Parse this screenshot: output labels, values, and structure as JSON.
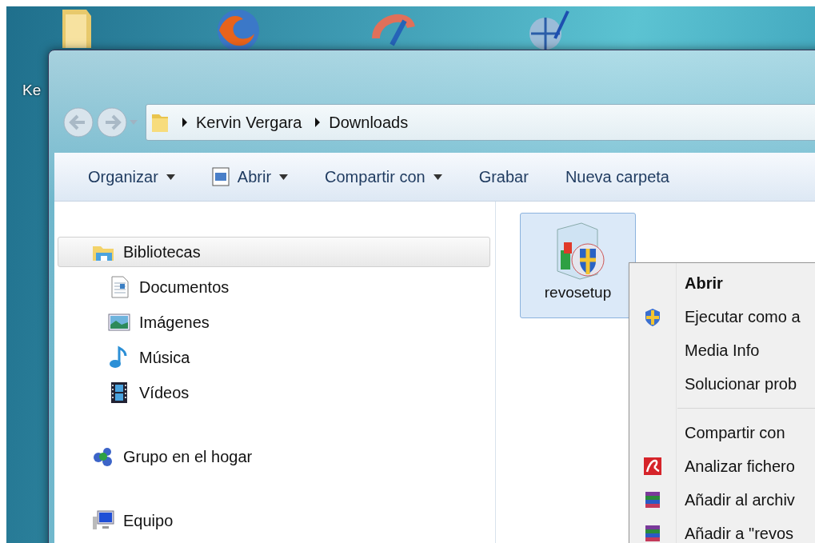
{
  "desktop": {
    "icon_label": "Ke"
  },
  "window": {
    "address_path": [
      "Kervin Vergara",
      "Downloads"
    ],
    "toolbar": [
      {
        "label": "Organizar",
        "kind": "menu"
      },
      {
        "label": "Abrir",
        "kind": "icon-menu"
      },
      {
        "label": "Compartir con",
        "kind": "menu"
      },
      {
        "label": "Grabar",
        "kind": "command"
      },
      {
        "label": "Nueva carpeta",
        "kind": "command"
      }
    ],
    "nav_pane": [
      {
        "label": "Bibliotecas",
        "kind": "library",
        "selected": true,
        "children": [
          {
            "label": "Documentos",
            "kind": "documents",
            "selected": false
          },
          {
            "label": "Imágenes",
            "kind": "pictures",
            "selected": false
          },
          {
            "label": "Música",
            "kind": "music",
            "selected": false
          },
          {
            "label": "Vídeos",
            "kind": "videos",
            "selected": false
          }
        ]
      },
      {
        "label": "Grupo en el hogar",
        "kind": "homegroup",
        "selected": false
      },
      {
        "label": "Equipo",
        "kind": "computer",
        "selected": false
      }
    ],
    "files": [
      {
        "name": "revosetup",
        "selected": true
      }
    ]
  },
  "context_menu": [
    {
      "label": "Abrir",
      "kind": "default"
    },
    {
      "label": "Ejecutar como a",
      "kind": "shield"
    },
    {
      "label": "Media Info",
      "kind": "plain"
    },
    {
      "label": "Solucionar prob",
      "kind": "plain"
    },
    {
      "kind": "separator"
    },
    {
      "label": "Compartir con",
      "kind": "plain"
    },
    {
      "label": "Analizar fichero",
      "kind": "antivirus"
    },
    {
      "label": "Añadir al archiv",
      "kind": "archive"
    },
    {
      "label": "Añadir a \"revos",
      "kind": "archive"
    }
  ]
}
